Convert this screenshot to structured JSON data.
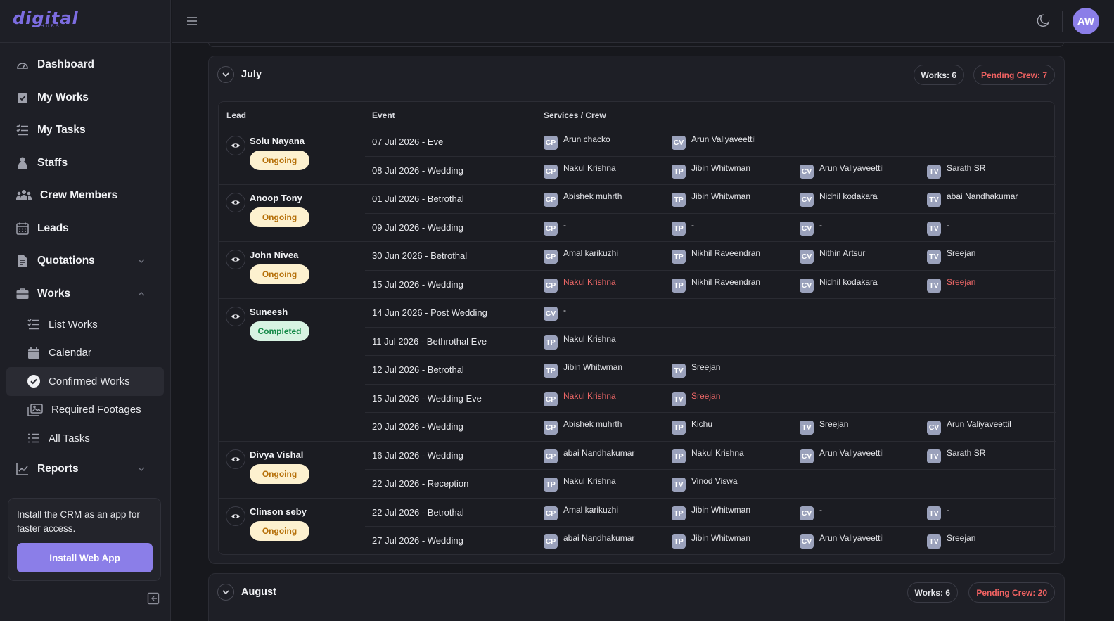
{
  "app": {
    "logo": "digital",
    "logo_sub": "HUBS"
  },
  "sidebar": {
    "items": [
      {
        "label": "Dashboard",
        "icon": "gauge-icon"
      },
      {
        "label": "My Works",
        "icon": "clipboard-check-icon"
      },
      {
        "label": "My Tasks",
        "icon": "list-check-icon"
      },
      {
        "label": "Staffs",
        "icon": "person-icon"
      },
      {
        "label": "Crew Members",
        "icon": "people-icon"
      },
      {
        "label": "Leads",
        "icon": "calendar-grid-icon"
      },
      {
        "label": "Quotations",
        "icon": "document-icon"
      },
      {
        "label": "Works",
        "icon": "briefcase-icon"
      }
    ],
    "works_sub": [
      {
        "label": "List Works"
      },
      {
        "label": "Calendar"
      },
      {
        "label": "Confirmed Works"
      },
      {
        "label": "Required Footages"
      },
      {
        "label": "All Tasks"
      }
    ],
    "reports": {
      "label": "Reports"
    },
    "install": {
      "text": "Install the CRM as an app for faster access.",
      "button": "Install Web App"
    }
  },
  "topbar": {
    "avatar": "AW"
  },
  "july": {
    "month": "July",
    "works": "Works:  6",
    "pending": "Pending Crew:  7",
    "headers": {
      "lead": "Lead",
      "event": "Event",
      "services": "Services / Crew"
    },
    "leads": [
      {
        "name": "Solu  Nayana",
        "status": "Ongoing"
      },
      {
        "name": "Anoop Tony",
        "status": "Ongoing"
      },
      {
        "name": "John Nivea",
        "status": "Ongoing"
      },
      {
        "name": "Suneesh",
        "status": "Completed"
      },
      {
        "name": "Divya Vishal",
        "status": "Ongoing"
      },
      {
        "name": "Clinson seby",
        "status": "Ongoing"
      }
    ],
    "rows": [
      {
        "event": "07 Jul 2026 - Eve",
        "crew": [
          {
            "tag": "CP",
            "name": "Arun chacko"
          },
          {
            "tag": "CV",
            "name": "Arun Valiyaveettil"
          }
        ]
      },
      {
        "event": "08 Jul 2026 - Wedding",
        "crew": [
          {
            "tag": "CP",
            "name": "Nakul Krishna"
          },
          {
            "tag": "TP",
            "name": "Jibin Whitwman"
          },
          {
            "tag": "CV",
            "name": "Arun Valiyaveettil"
          },
          {
            "tag": "TV",
            "name": "Sarath SR"
          }
        ]
      },
      {
        "event": "01 Jul 2026 - Betrothal",
        "crew": [
          {
            "tag": "CP",
            "name": "Abishek muhrth"
          },
          {
            "tag": "TP",
            "name": "Jibin Whitwman"
          },
          {
            "tag": "CV",
            "name": "Nidhil kodakara"
          },
          {
            "tag": "TV",
            "name": "abai Nandhakumar"
          }
        ]
      },
      {
        "event": "09 Jul 2026 - Wedding",
        "crew": [
          {
            "tag": "CP",
            "name": "-"
          },
          {
            "tag": "TP",
            "name": "-"
          },
          {
            "tag": "CV",
            "name": "-"
          },
          {
            "tag": "TV",
            "name": "-"
          }
        ]
      },
      {
        "event": "30 Jun 2026 - Betrothal",
        "crew": [
          {
            "tag": "CP",
            "name": "Amal karikuzhi"
          },
          {
            "tag": "TP",
            "name": "Nikhil Raveendran"
          },
          {
            "tag": "CV",
            "name": "Nithin Artsur"
          },
          {
            "tag": "TV",
            "name": "Sreejan"
          }
        ]
      },
      {
        "event": "15 Jul 2026 - Wedding",
        "crew": [
          {
            "tag": "CP",
            "name": "Nakul Krishna",
            "conflict": true
          },
          {
            "tag": "TP",
            "name": "Nikhil Raveendran"
          },
          {
            "tag": "CV",
            "name": "Nidhil kodakara"
          },
          {
            "tag": "TV",
            "name": "Sreejan",
            "conflict": true
          }
        ]
      },
      {
        "event": "14 Jun 2026 - Post Wedding",
        "crew": [
          {
            "tag": "CV",
            "name": "-"
          }
        ]
      },
      {
        "event": "11 Jul 2026 - Bethrothal Eve",
        "crew": [
          {
            "tag": "TP",
            "name": "Nakul Krishna"
          }
        ]
      },
      {
        "event": "12 Jul 2026 - Betrothal",
        "crew": [
          {
            "tag": "TP",
            "name": "Jibin Whitwman"
          },
          {
            "tag": "TV",
            "name": "Sreejan"
          }
        ]
      },
      {
        "event": "15 Jul 2026 - Wedding Eve",
        "crew": [
          {
            "tag": "CP",
            "name": "Nakul Krishna",
            "conflict": true
          },
          {
            "tag": "TV",
            "name": "Sreejan",
            "conflict": true
          }
        ]
      },
      {
        "event": "20 Jul 2026 - Wedding",
        "crew": [
          {
            "tag": "CP",
            "name": "Abishek muhrth"
          },
          {
            "tag": "TP",
            "name": "Kichu"
          },
          {
            "tag": "TV",
            "name": "Sreejan"
          },
          {
            "tag": "CV",
            "name": "Arun Valiyaveettil"
          }
        ]
      },
      {
        "event": "16 Jul 2026 - Wedding",
        "crew": [
          {
            "tag": "CP",
            "name": "abai Nandhakumar"
          },
          {
            "tag": "TP",
            "name": "Nakul Krishna"
          },
          {
            "tag": "CV",
            "name": "Arun Valiyaveettil"
          },
          {
            "tag": "TV",
            "name": "Sarath SR"
          }
        ]
      },
      {
        "event": "22 Jul 2026 - Reception",
        "crew": [
          {
            "tag": "TP",
            "name": "Nakul Krishna"
          },
          {
            "tag": "TV",
            "name": "Vinod Viswa"
          }
        ]
      },
      {
        "event": "22 Jul 2026 - Betrothal",
        "crew": [
          {
            "tag": "CP",
            "name": "Amal karikuzhi"
          },
          {
            "tag": "TP",
            "name": "Jibin Whitwman"
          },
          {
            "tag": "CV",
            "name": "-"
          },
          {
            "tag": "TV",
            "name": "-"
          }
        ]
      },
      {
        "event": "27 Jul 2026 - Wedding",
        "crew": [
          {
            "tag": "CP",
            "name": "abai Nandhakumar"
          },
          {
            "tag": "TP",
            "name": "Jibin Whitwman"
          },
          {
            "tag": "CV",
            "name": "Arun Valiyaveettil"
          },
          {
            "tag": "TV",
            "name": "Sreejan"
          }
        ]
      }
    ]
  },
  "august": {
    "month": "August",
    "works": "Works:  6",
    "pending": "Pending Crew:  20"
  }
}
